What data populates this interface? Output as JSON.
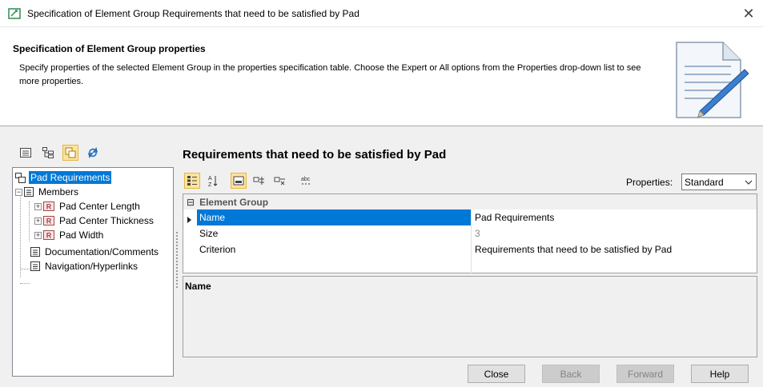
{
  "window": {
    "title": "Specification of Element Group Requirements that need to be satisfied by Pad",
    "close_glyph": "✕"
  },
  "header": {
    "title": "Specification of Element Group properties",
    "description": "Specify properties of the selected Element Group in the properties specification table. Choose the Expert or All options from the Properties drop-down list to see more properties."
  },
  "tree": {
    "items": [
      {
        "label": "Pad Requirements",
        "selected": true
      },
      {
        "label": "Members"
      },
      {
        "label": "Pad Center Length"
      },
      {
        "label": "Pad Center Thickness"
      },
      {
        "label": "Pad Width"
      },
      {
        "label": "Documentation/Comments"
      },
      {
        "label": "Navigation/Hyperlinks"
      }
    ]
  },
  "main": {
    "title": "Requirements that need to be satisfied by Pad",
    "properties_label": "Properties:",
    "properties_value": "Standard",
    "group_label": "Element Group",
    "group_toggle": "⊟",
    "rows": [
      {
        "key": "Name",
        "value": "Pad Requirements"
      },
      {
        "key": "Size",
        "value": "3"
      },
      {
        "key": "Criterion",
        "value": "Requirements that need to be satisfied by Pad"
      }
    ],
    "description_title": "Name"
  },
  "buttons": {
    "close": "Close",
    "back": "Back",
    "forward": "Forward",
    "help": "Help"
  },
  "colors": {
    "selection": "#0078d7",
    "active_toggle": "#fde49b"
  }
}
